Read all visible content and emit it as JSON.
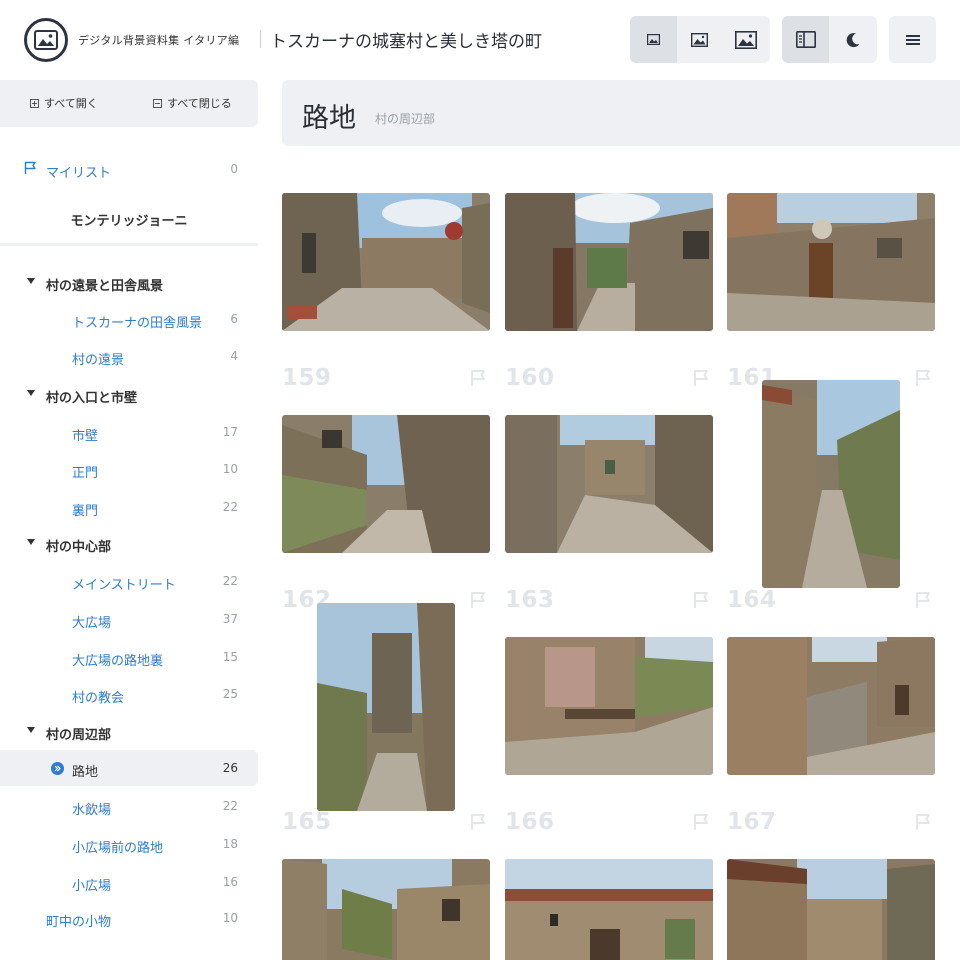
{
  "header": {
    "brand": "デジタル背景資料集 イタリア編",
    "title": "トスカーナの城塞村と美しき塔の町",
    "icons": [
      "image-small-icon",
      "image-medium-icon",
      "image-large-icon",
      "sidebar-toggle-icon",
      "dark-mode-icon",
      "menu-icon"
    ]
  },
  "sidebar": {
    "expand_all": "すべて開く",
    "collapse_all": "すべて閉じる",
    "mylist": {
      "label": "マイリスト",
      "count": "0"
    },
    "location": "モンテリッジョーニ",
    "groups": [
      {
        "label": "村の遠景と田舎風景",
        "items": [
          {
            "label": "トスカーナの田舎風景",
            "count": "6"
          },
          {
            "label": "村の遠景",
            "count": "4"
          }
        ]
      },
      {
        "label": "村の入口と市壁",
        "items": [
          {
            "label": "市壁",
            "count": "17"
          },
          {
            "label": "正門",
            "count": "10"
          },
          {
            "label": "裏門",
            "count": "22"
          }
        ]
      },
      {
        "label": "村の中心部",
        "items": [
          {
            "label": "メインストリート",
            "count": "22"
          },
          {
            "label": "大広場",
            "count": "37"
          },
          {
            "label": "大広場の路地裏",
            "count": "15"
          },
          {
            "label": "村の教会",
            "count": "25"
          }
        ]
      },
      {
        "label": "村の周辺部",
        "items": [
          {
            "label": "路地",
            "count": "26",
            "selected": true
          },
          {
            "label": "水飲場",
            "count": "22"
          },
          {
            "label": "小広場前の路地",
            "count": "18"
          },
          {
            "label": "小広場",
            "count": "16"
          }
        ]
      }
    ],
    "extra": {
      "label": "町中の小物",
      "count": "10"
    }
  },
  "main": {
    "title": "路地",
    "subtitle": "村の周辺部",
    "photos": [
      {
        "num": "159"
      },
      {
        "num": "160"
      },
      {
        "num": "161"
      },
      {
        "num": "162"
      },
      {
        "num": "163"
      },
      {
        "num": "164"
      },
      {
        "num": "165"
      },
      {
        "num": "166"
      },
      {
        "num": "167"
      },
      {
        "num": ""
      },
      {
        "num": ""
      },
      {
        "num": ""
      }
    ]
  },
  "colors": {
    "accent": "#2d7cd0",
    "panel": "#eef0f3",
    "text": "#333333"
  }
}
